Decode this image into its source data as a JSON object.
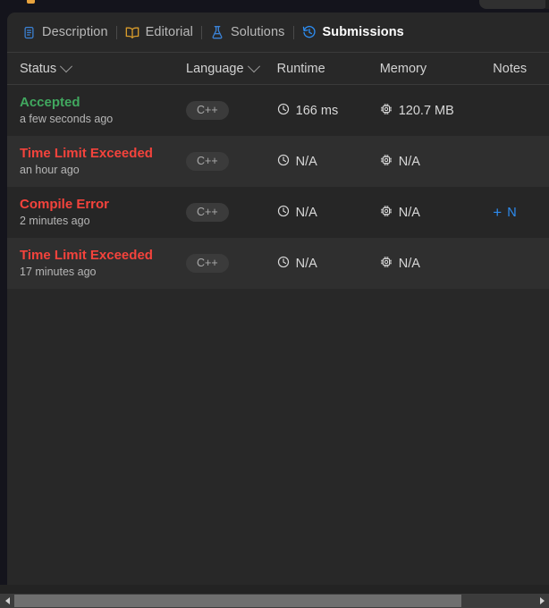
{
  "window": {
    "background_color": "#14141c",
    "panel_color": "#282828"
  },
  "tabs": [
    {
      "id": "description",
      "label": "Description",
      "icon": "document-icon",
      "icon_color": "#3b82d6",
      "active": false
    },
    {
      "id": "editorial",
      "label": "Editorial",
      "icon": "book-icon",
      "icon_color": "#d79b2b",
      "active": false
    },
    {
      "id": "solutions",
      "label": "Solutions",
      "icon": "flask-icon",
      "icon_color": "#3b82d6",
      "active": false
    },
    {
      "id": "submissions",
      "label": "Submissions",
      "icon": "history-clock-icon",
      "icon_color": "#2d8cf0",
      "active": true
    }
  ],
  "table": {
    "columns": [
      {
        "id": "status",
        "label": "Status",
        "sortable": true
      },
      {
        "id": "language",
        "label": "Language",
        "sortable": true
      },
      {
        "id": "runtime",
        "label": "Runtime",
        "sortable": false
      },
      {
        "id": "memory",
        "label": "Memory",
        "sortable": false
      },
      {
        "id": "notes",
        "label": "Notes",
        "sortable": false
      }
    ],
    "rows": [
      {
        "status": "Accepted",
        "status_color": "#41a85f",
        "time": "a few seconds ago",
        "language": "C++",
        "runtime": "166 ms",
        "memory": "120.7 MB",
        "note_label": "",
        "has_note_link": false
      },
      {
        "status": "Time Limit Exceeded",
        "status_color": "#f4433c",
        "time": "an hour ago",
        "language": "C++",
        "runtime": "N/A",
        "memory": "N/A",
        "note_label": "",
        "has_note_link": false
      },
      {
        "status": "Compile Error",
        "status_color": "#f4433c",
        "time": "2 minutes ago",
        "language": "C++",
        "runtime": "N/A",
        "memory": "N/A",
        "note_label": "N",
        "has_note_link": true
      },
      {
        "status": "Time Limit Exceeded",
        "status_color": "#f4433c",
        "time": "17 minutes ago",
        "language": "C++",
        "runtime": "N/A",
        "memory": "N/A",
        "note_label": "",
        "has_note_link": false
      }
    ]
  },
  "scrollbar": {
    "orientation": "horizontal",
    "left_arrow": "◀",
    "right_arrow": "▶"
  },
  "colors": {
    "accent_blue": "#2d8cf0",
    "accepted_green": "#41a85f",
    "error_red": "#f4433c",
    "badge_bg": "#3b3b3b"
  }
}
